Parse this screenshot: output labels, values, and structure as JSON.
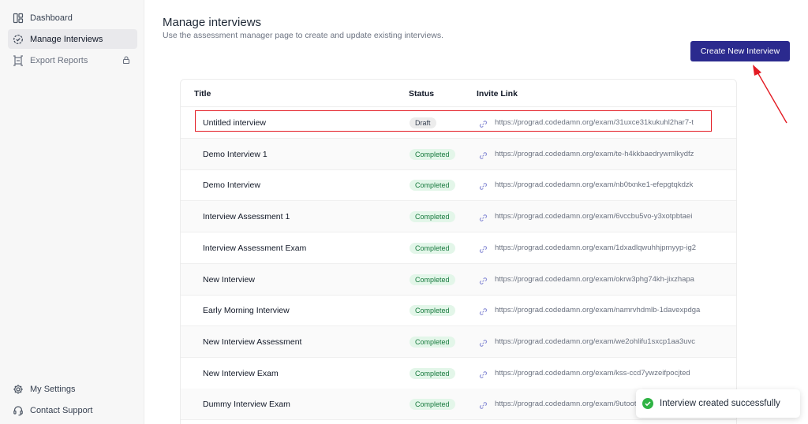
{
  "sidebar": {
    "top_items": [
      {
        "label": "Dashboard",
        "icon": "layout-icon"
      },
      {
        "label": "Manage Interviews",
        "icon": "interviews-icon",
        "active": true
      },
      {
        "label": "Export Reports",
        "icon": "export-icon",
        "locked": true
      }
    ],
    "bottom_items": [
      {
        "label": "My Settings",
        "icon": "gear-icon"
      },
      {
        "label": "Contact Support",
        "icon": "headset-icon"
      }
    ]
  },
  "header": {
    "title": "Manage interviews",
    "subtitle": "Use the assessment manager page to create and update existing interviews.",
    "create_button": "Create New Interview"
  },
  "table": {
    "columns": [
      "Title",
      "Status",
      "Invite Link"
    ],
    "rows": [
      {
        "title": "Untitled interview",
        "status": "Draft",
        "link": "https://prograd.codedamn.org/exam/31uxce31kukuhl2har7-t"
      },
      {
        "title": "Demo Interview 1",
        "status": "Completed",
        "link": "https://prograd.codedamn.org/exam/te-h4kkbaedrywmlkydfz"
      },
      {
        "title": "Demo Interview",
        "status": "Completed",
        "link": "https://prograd.codedamn.org/exam/nb0txnke1-efepgtqkdzk"
      },
      {
        "title": "Interview Assessment 1",
        "status": "Completed",
        "link": "https://prograd.codedamn.org/exam/6vccbu5vo-y3xotpbtaei"
      },
      {
        "title": "Interview Assessment Exam",
        "status": "Completed",
        "link": "https://prograd.codedamn.org/exam/1dxadlqwuhhjpmyyp-ig2"
      },
      {
        "title": "New Interview",
        "status": "Completed",
        "link": "https://prograd.codedamn.org/exam/okrw3phg74kh-jixzhapa"
      },
      {
        "title": "Early Morning Interview",
        "status": "Completed",
        "link": "https://prograd.codedamn.org/exam/namrvhdmlb-1davexpdga"
      },
      {
        "title": "New Interview Assessment",
        "status": "Completed",
        "link": "https://prograd.codedamn.org/exam/we2ohlifu1sxcp1aa3uvc"
      },
      {
        "title": "New Interview Exam",
        "status": "Completed",
        "link": "https://prograd.codedamn.org/exam/kss-ccd7ywzeifpocjted"
      },
      {
        "title": "Dummy Interview Exam",
        "status": "Completed",
        "link": "https://prograd.codedamn.org/exam/9utootj"
      }
    ]
  },
  "toast": {
    "message": "Interview created successfully"
  },
  "colors": {
    "accent": "#2b2a8e",
    "annotation": "#e31b23",
    "success": "#2fb344"
  }
}
